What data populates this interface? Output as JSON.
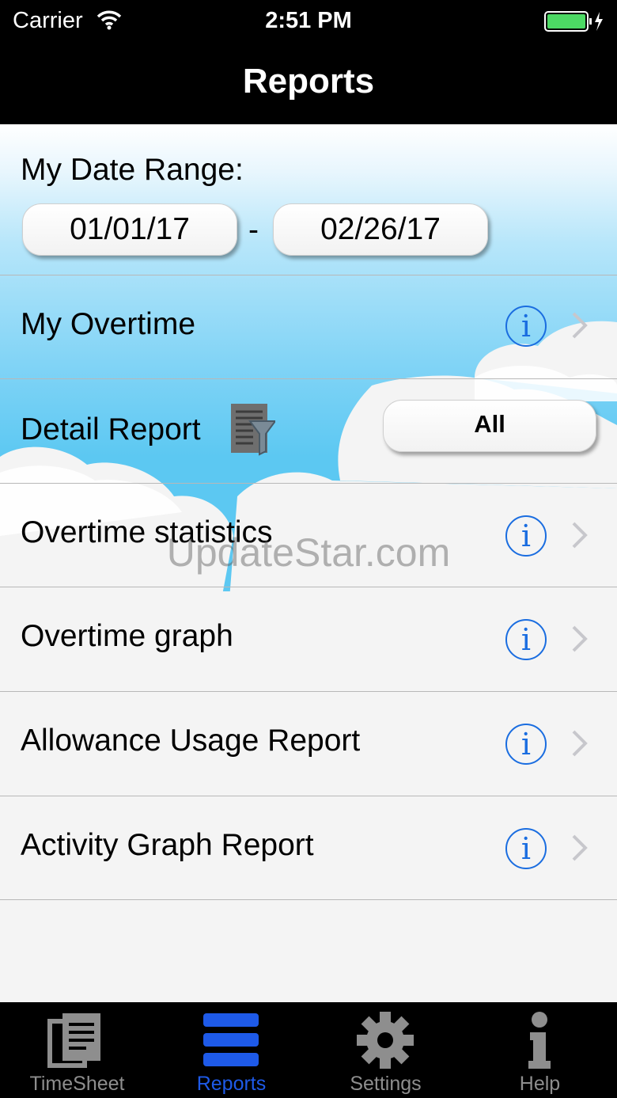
{
  "status_bar": {
    "carrier": "Carrier",
    "time": "2:51 PM"
  },
  "nav": {
    "title": "Reports"
  },
  "date_range": {
    "label": "My Date Range:",
    "start": "01/01/17",
    "separator": "-",
    "end": "02/26/17"
  },
  "rows": [
    {
      "label": "My Overtime",
      "icon": "info-icon"
    },
    {
      "label": "Detail Report",
      "filter_value": "All"
    },
    {
      "label": "Overtime statistics",
      "icon": "info-icon"
    },
    {
      "label": "Overtime graph",
      "icon": "info-icon"
    },
    {
      "label": "Allowance Usage Report",
      "icon": "info-icon"
    },
    {
      "label": "Activity Graph Report",
      "icon": "info-icon"
    }
  ],
  "info_glyph": "i",
  "watermark": "UpdateStar.com",
  "tabs": [
    {
      "label": "TimeSheet",
      "icon": "timesheet-icon",
      "active": false
    },
    {
      "label": "Reports",
      "icon": "reports-icon",
      "active": true
    },
    {
      "label": "Settings",
      "icon": "gear-icon",
      "active": false
    },
    {
      "label": "Help",
      "icon": "help-icon",
      "active": false
    }
  ],
  "colors": {
    "accent": "#1e5ae8",
    "info_blue": "#1a6de0",
    "sky": "#5cc8f2",
    "battery": "#4cd964"
  }
}
